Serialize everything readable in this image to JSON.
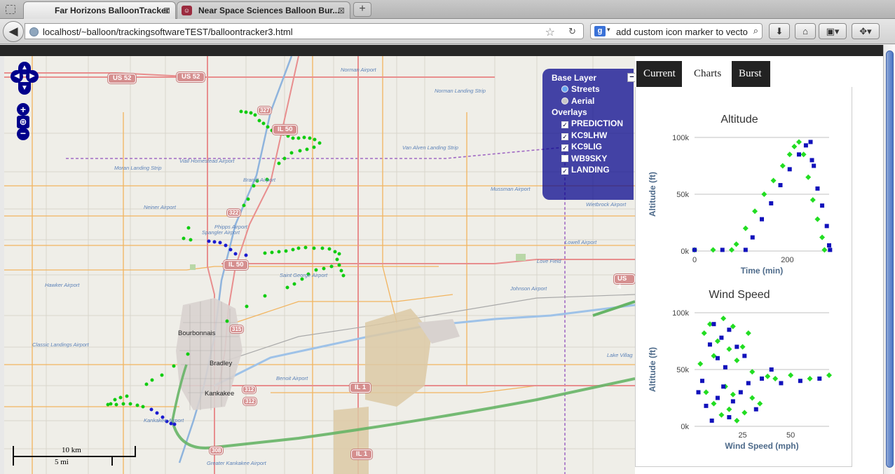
{
  "browser": {
    "tabs": [
      {
        "label": "Far Horizons BalloonTracker",
        "close": "⊠"
      },
      {
        "label": "Near Space Sciences Balloon Bur...",
        "close": "⊠"
      }
    ],
    "new_tab": "+",
    "url": "localhost/~balloon/trackingsoftwareTEST/balloontracker3.html",
    "search_value": "add custom icon marker to vecto",
    "search_engine_icon": "g"
  },
  "map": {
    "labels": {
      "norman": "Norman Airport",
      "norman_heliport": "Norman Landing Strip",
      "vanalven": "Van Alven Landing Strip",
      "viall": "Viall Homestead Airport",
      "moran": "Moran Landing Strip",
      "brandt": "Brandt Airport",
      "mussman": "Mussman Airport",
      "neiner": "Neiner Airport",
      "wietbrock": "Wietbrock Airport",
      "phipps": "Phipps Airport",
      "spangler": "Spangler Airport",
      "lowell": "Lowell Airport",
      "lovefield": "Love Field",
      "saintgeorge": "Saint George Airport",
      "hawker": "Hawker Airport",
      "johnson": "Johnson Airport",
      "classic": "Classic Landings Airport",
      "benoit": "Benoit Airport",
      "lakevillage": "Lake Villag",
      "kankakee_ap": "Kankakee Airport",
      "greater": "Greater Kankakee Airport",
      "bourbonnais": "Bourbonnais",
      "bradley": "Bradley",
      "kankakee": "Kankakee"
    },
    "shields": {
      "us52a": "US 52",
      "us52b": "US 52",
      "il50a": "IL 50",
      "il50b": "IL 50",
      "il1a": "IL 1",
      "il1b": "IL 1",
      "us4": "US 4",
      "r327": "327",
      "r322": "322",
      "r315": "315",
      "r312a": "312",
      "r312b": "312",
      "r308": "308"
    },
    "controls": {
      "zoom_in": "+",
      "zoom_out": "−",
      "world": "⊕"
    },
    "layer_switcher": {
      "base_title": "Base Layer",
      "base_layers": [
        {
          "label": "Streets",
          "selected": true
        },
        {
          "label": "Aerial",
          "selected": false
        }
      ],
      "overlays_title": "Overlays",
      "overlays": [
        {
          "label": "PREDICTION",
          "checked": true
        },
        {
          "label": "KC9LHW",
          "checked": true
        },
        {
          "label": "KC9LIG",
          "checked": true
        },
        {
          "label": "WB9SKY",
          "checked": false
        },
        {
          "label": "LANDING",
          "checked": true
        }
      ],
      "minimize": "−"
    },
    "scale": {
      "km": "10 km",
      "mi": "5 mi"
    }
  },
  "panel": {
    "tabs": [
      "Current",
      "Charts",
      "Burst"
    ],
    "active_tab": "Charts"
  },
  "colors": {
    "green_series": "#22dd22",
    "blue_series": "#1111bb"
  },
  "chart_data": [
    {
      "type": "scatter",
      "title": "Altitude",
      "xlabel": "Time (min)",
      "ylabel": "Altitude (ft)",
      "xlim": [
        0,
        290
      ],
      "ylim": [
        0,
        100000
      ],
      "x_ticks": [
        "0",
        "200"
      ],
      "y_ticks": [
        "0k",
        "50k",
        "100k"
      ],
      "grid": true,
      "series": [
        {
          "color": "#22dd22",
          "points": [
            [
              0,
              1000
            ],
            [
              40,
              1000
            ],
            [
              80,
              1000
            ],
            [
              90,
              6000
            ],
            [
              110,
              20000
            ],
            [
              130,
              35000
            ],
            [
              150,
              50000
            ],
            [
              170,
              62000
            ],
            [
              190,
              75000
            ],
            [
              205,
              85000
            ],
            [
              215,
              92000
            ],
            [
              225,
              96000
            ],
            [
              235,
              85000
            ],
            [
              245,
              65000
            ],
            [
              255,
              45000
            ],
            [
              265,
              28000
            ],
            [
              275,
              12000
            ],
            [
              280,
              1000
            ]
          ]
        },
        {
          "color": "#1111bb",
          "points": [
            [
              0,
              1000
            ],
            [
              60,
              1000
            ],
            [
              110,
              1000
            ],
            [
              125,
              12000
            ],
            [
              145,
              28000
            ],
            [
              165,
              42000
            ],
            [
              185,
              58000
            ],
            [
              205,
              72000
            ],
            [
              225,
              85000
            ],
            [
              240,
              93000
            ],
            [
              250,
              96000
            ],
            [
              253,
              80000
            ],
            [
              257,
              75000
            ],
            [
              265,
              55000
            ],
            [
              275,
              40000
            ],
            [
              285,
              22000
            ],
            [
              290,
              5000
            ],
            [
              292,
              1000
            ]
          ]
        }
      ]
    },
    {
      "type": "scatter",
      "title": "Wind Speed",
      "xlabel": "Wind Speed (mph)",
      "ylabel": "Altitude (ft)",
      "xlim": [
        0,
        70
      ],
      "ylim": [
        0,
        100000
      ],
      "x_ticks": [
        "25",
        "50"
      ],
      "y_ticks": [
        "0k",
        "50k",
        "100k"
      ],
      "grid": true,
      "series": [
        {
          "color": "#22dd22",
          "points": [
            [
              3,
              55000
            ],
            [
              5,
              82000
            ],
            [
              8,
              90000
            ],
            [
              10,
              62000
            ],
            [
              12,
              75000
            ],
            [
              15,
              95000
            ],
            [
              18,
              68000
            ],
            [
              20,
              88000
            ],
            [
              22,
              58000
            ],
            [
              25,
              70000
            ],
            [
              28,
              82000
            ],
            [
              30,
              48000
            ],
            [
              38,
              44000
            ],
            [
              42,
              42000
            ],
            [
              50,
              45000
            ],
            [
              60,
              42000
            ],
            [
              70,
              45000
            ],
            [
              6,
              30000
            ],
            [
              10,
              20000
            ],
            [
              14,
              10000
            ],
            [
              18,
              15000
            ],
            [
              22,
              5000
            ],
            [
              26,
              12000
            ],
            [
              30,
              25000
            ],
            [
              34,
              20000
            ],
            [
              16,
              35000
            ],
            [
              20,
              28000
            ]
          ]
        },
        {
          "color": "#1111bb",
          "points": [
            [
              2,
              30000
            ],
            [
              6,
              18000
            ],
            [
              9,
              5000
            ],
            [
              12,
              25000
            ],
            [
              15,
              35000
            ],
            [
              18,
              8000
            ],
            [
              20,
              22000
            ],
            [
              24,
              30000
            ],
            [
              28,
              38000
            ],
            [
              32,
              15000
            ],
            [
              10,
              90000
            ],
            [
              14,
              78000
            ],
            [
              18,
              85000
            ],
            [
              22,
              70000
            ],
            [
              26,
              62000
            ],
            [
              12,
              60000
            ],
            [
              16,
              52000
            ],
            [
              45,
              38000
            ],
            [
              55,
              40000
            ],
            [
              65,
              42000
            ],
            [
              40,
              50000
            ],
            [
              35,
              42000
            ],
            [
              8,
              72000
            ],
            [
              4,
              40000
            ]
          ]
        }
      ]
    }
  ]
}
